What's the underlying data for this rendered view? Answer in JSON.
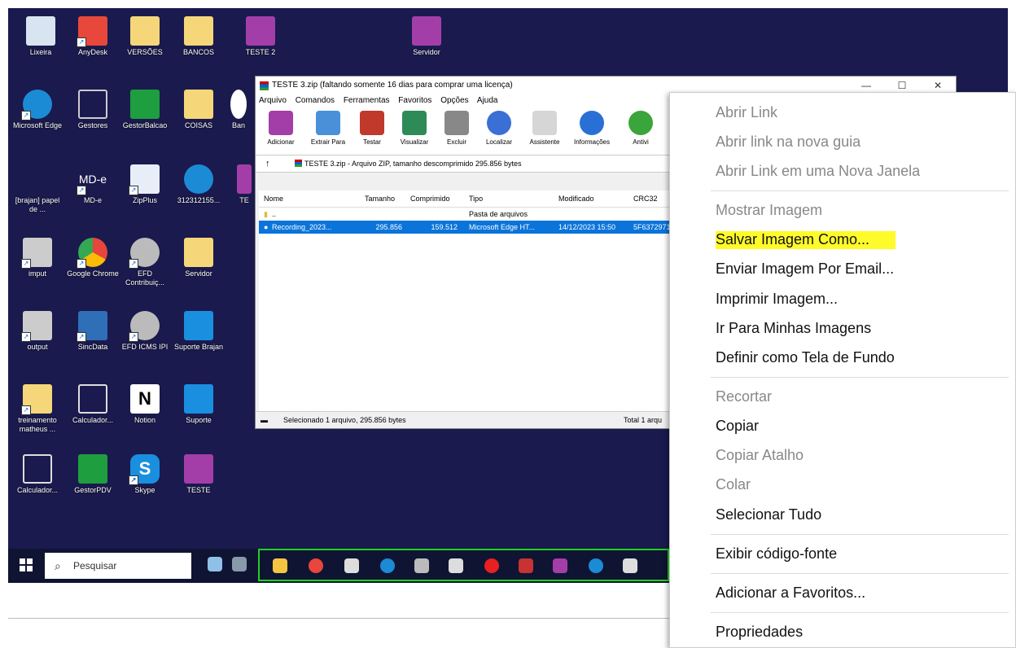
{
  "desktop": {
    "icons": [
      {
        "name": "Lixeira",
        "color": "#d8e4f0"
      },
      {
        "name": "AnyDesk",
        "color": "#e8483b"
      },
      {
        "name": "VERSÕES",
        "color": "#f5d77a"
      },
      {
        "name": "BANCOS",
        "color": "#f5d77a"
      },
      {
        "name": "TESTE 2",
        "color": "#a33ea8"
      },
      {
        "name": "Servidor",
        "color": "#a33ea8"
      },
      {
        "name": "Microsoft Edge",
        "color": "#1c8bd6"
      },
      {
        "name": "Gestores",
        "color": "#1a1a4e"
      },
      {
        "name": "GestorBalcao",
        "color": "#1e9e3e"
      },
      {
        "name": "COISAS",
        "color": "#f5d77a"
      },
      {
        "name": "Ban",
        "color": "#ffffff"
      },
      {
        "name": "[brajan] papel de ...",
        "color": "#1a1a4e"
      },
      {
        "name": "MD-e",
        "color": "#1a1a4e"
      },
      {
        "name": "ZipPlus",
        "color": "#e8eef8"
      },
      {
        "name": "312312155...",
        "color": "#1c8bd6"
      },
      {
        "name": "TE",
        "color": "#a33ea8"
      },
      {
        "name": "imput",
        "color": "#cccccc"
      },
      {
        "name": "Google Chrome",
        "color": "#e8453c"
      },
      {
        "name": "EFD Contribuiç...",
        "color": "#bbbbbb"
      },
      {
        "name": "Servidor",
        "color": "#f5d77a"
      },
      {
        "name": "output",
        "color": "#cccccc"
      },
      {
        "name": "SincData",
        "color": "#2f6fb8"
      },
      {
        "name": "EFD ICMS IPI",
        "color": "#bbbbbb"
      },
      {
        "name": "Suporte Brajan",
        "color": "#1a8fe0"
      },
      {
        "name": "treinamento matheus ...",
        "color": "#f5d77a"
      },
      {
        "name": "Calculador...",
        "color": "#1a1a4e"
      },
      {
        "name": "Notion",
        "color": "#ffffff"
      },
      {
        "name": "Suporte",
        "color": "#1a8fe0"
      },
      {
        "name": "Calculador...",
        "color": "#1a1a4e"
      },
      {
        "name": "GestorPDV",
        "color": "#1e9e3e"
      },
      {
        "name": "Skype",
        "color": "#1a8fe0"
      },
      {
        "name": "TESTE",
        "color": "#a33ea8"
      }
    ]
  },
  "winrar": {
    "title": "TESTE 3.zip (faltando somente 16 dias para comprar uma licença)",
    "controls": {
      "minimize": "—",
      "maximize": "☐",
      "close": "✕"
    },
    "menu": [
      "Arquivo",
      "Comandos",
      "Ferramentas",
      "Favoritos",
      "Opções",
      "Ajuda"
    ],
    "toolbar": [
      {
        "label": "Adicionar",
        "color": "#a33ea8"
      },
      {
        "label": "Extrair Para",
        "color": "#4a90d9"
      },
      {
        "label": "Testar",
        "color": "#c0392b"
      },
      {
        "label": "Visualizar",
        "color": "#2e8b57"
      },
      {
        "label": "Excluir",
        "color": "#888888"
      },
      {
        "label": "Localizar",
        "color": "#3a6fd6"
      },
      {
        "label": "Assistente",
        "color": "#d6d6d6"
      },
      {
        "label": "Informações",
        "color": "#2a6fd6"
      },
      {
        "label": "Antivi",
        "color": "#3aa53a"
      }
    ],
    "address": "TESTE 3.zip - Arquivo ZIP, tamanho descomprimido 295.856 bytes",
    "columns": [
      "Nome",
      "Tamanho",
      "Comprimido",
      "Tipo",
      "Modificado",
      "CRC32"
    ],
    "rows": [
      {
        "name": "..",
        "size": "",
        "packed": "",
        "type": "Pasta de arquivos",
        "modified": "",
        "crc": ""
      },
      {
        "name": "Recording_2023...",
        "size": "295.856",
        "packed": "159.512",
        "type": "Microsoft Edge HT...",
        "modified": "14/12/2023 15:50",
        "crc": "5F6372971"
      }
    ],
    "status_left": "Selecionado 1 arquivo, 295.856 bytes",
    "status_right": "Total 1 arqu"
  },
  "taskbar": {
    "search_placeholder": "Pesquisar",
    "apps": [
      "#f5c542",
      "#e8453c",
      "#dddddd",
      "#1c8bd6",
      "#bbbbbb",
      "#dddddd",
      "#e82020",
      "#c83232",
      "#a33ea8",
      "#1c8bd6",
      "#dddddd"
    ]
  },
  "context_menu": {
    "items": [
      {
        "label": "Abrir Link",
        "disabled": true
      },
      {
        "label": "Abrir link na nova guia",
        "disabled": true
      },
      {
        "label": "Abrir Link em uma Nova Janela",
        "disabled": true
      },
      {
        "label": "Mostrar Imagem",
        "disabled": true
      },
      {
        "label": "Salvar Imagem Como...",
        "disabled": false,
        "highlight": "#fffb2a"
      },
      {
        "label": "Enviar Imagem Por Email...",
        "disabled": false
      },
      {
        "label": "Imprimir Imagem...",
        "disabled": false
      },
      {
        "label": "Ir Para Minhas Imagens",
        "disabled": false
      },
      {
        "label": "Definir como Tela de Fundo",
        "disabled": false
      },
      {
        "label": "Recortar",
        "disabled": true
      },
      {
        "label": "Copiar",
        "disabled": false
      },
      {
        "label": "Copiar Atalho",
        "disabled": true
      },
      {
        "label": "Colar",
        "disabled": true
      },
      {
        "label": "Selecionar Tudo",
        "disabled": false
      },
      {
        "label": "Exibir código-fonte",
        "disabled": false
      },
      {
        "label": "Adicionar a Favoritos...",
        "disabled": false
      },
      {
        "label": "Propriedades",
        "disabled": false
      }
    ]
  }
}
